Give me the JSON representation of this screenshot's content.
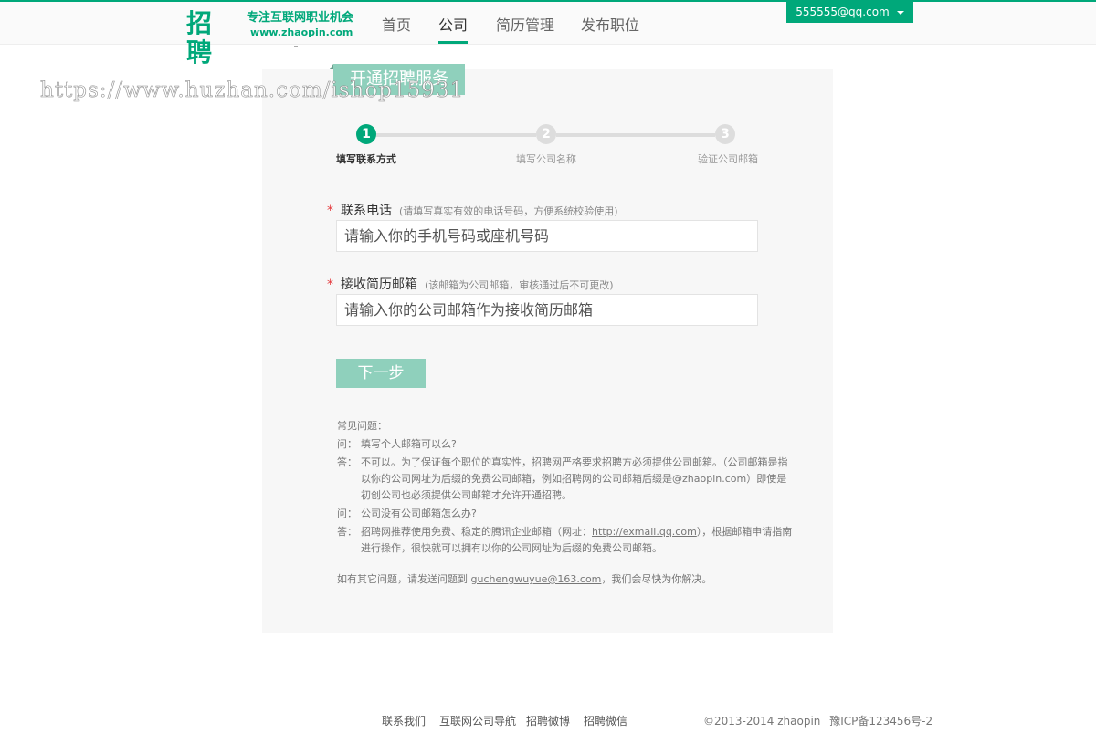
{
  "brand": {
    "logo_text": "招聘",
    "slogan": "专注互联网职业机会",
    "url": "www.zhaopin.com",
    "accent_color": "#00a87a"
  },
  "nav": {
    "items": [
      "首页",
      "公司",
      "简历管理",
      "发布职位"
    ],
    "active": "公司"
  },
  "user": {
    "email": "555555@qq.com",
    "caret_icon": "caret-down-icon"
  },
  "watermark": "https://www.huzhan.com/ishop15931",
  "service_tab": "开通招聘服务",
  "steps": [
    {
      "number": "1",
      "label": "填写联系方式",
      "state": "active"
    },
    {
      "number": "2",
      "label": "填写公司名称",
      "state": "pending"
    },
    {
      "number": "3",
      "label": "验证公司邮箱",
      "state": "pending"
    }
  ],
  "form": {
    "required_mark": "*",
    "phone": {
      "label": "联系电话",
      "hint": "(请填写真实有效的电话号码，方便系统校验使用)",
      "placeholder": "请输入你的手机号码或座机号码"
    },
    "email": {
      "label": "接收简历邮箱",
      "hint": "(该邮箱为公司邮箱，审核通过后不可更改)",
      "placeholder": "请输入你的公司邮箱作为接收简历邮箱"
    },
    "next_button": "下一步"
  },
  "faq": {
    "title": "常见问题：",
    "q_prefix": "问：",
    "a_prefix": "答：",
    "items": [
      {
        "q": "填写个人邮箱可以么?",
        "a": "不可以。为了保证每个职位的真实性，招聘网严格要求招聘方必须提供公司邮箱。（公司邮箱是指以你的公司网址为后缀的免费公司邮箱，例如招聘网的公司邮箱后缀是@zhaopin.com）即使是初创公司也必须提供公司邮箱才允许开通招聘。"
      },
      {
        "q": "公司没有公司邮箱怎么办?",
        "a_before": "招聘网推荐使用免费、稳定的腾讯企业邮箱（网址：",
        "a_link": "http://exmail.qq.com",
        "a_after": "），根据邮箱申请指南进行操作，很快就可以拥有以你的公司网址为后缀的免费公司邮箱。"
      }
    ],
    "contact_before": "如有其它问题，请发送问题到",
    "contact_email": "guchengwuyue@163.com",
    "contact_after": "，我们会尽快为你解决。"
  },
  "footer": {
    "links": [
      "联系我们",
      "互联网公司导航",
      "招聘微博",
      "招聘微信"
    ],
    "copyright": "©2013-2014 zhaopin",
    "icp": "豫ICP备123456号-2"
  }
}
